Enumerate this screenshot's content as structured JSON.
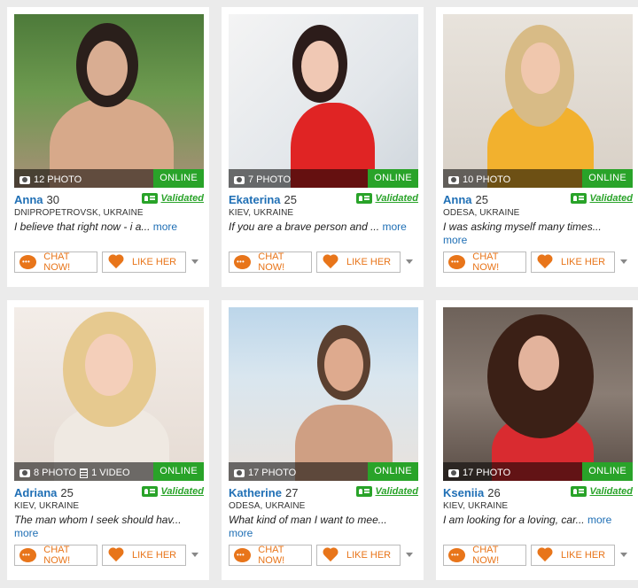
{
  "colors": {
    "online": "#29a329",
    "validated": "#29a329",
    "name": "#1f6fb5",
    "accent": "#e8751a"
  },
  "labels": {
    "online": "ONLINE",
    "validated": "Validated",
    "chat": "CHAT NOW!",
    "like": "LIKE HER",
    "more": "more"
  },
  "profiles": [
    {
      "photos": "12 PHOTO",
      "videos": "",
      "name": "Anna",
      "age": "30",
      "location": "DNIPROPETROVSK, UKRAINE",
      "bio": "I believe that right now - i a...",
      "more_inline": true
    },
    {
      "photos": "7 PHOTO",
      "videos": "",
      "name": "Ekaterina",
      "age": "25",
      "location": "KIEV, UKRAINE",
      "bio": "If you are a brave person and ...",
      "more_inline": true
    },
    {
      "photos": "10 PHOTO",
      "videos": "",
      "name": "Anna",
      "age": "25",
      "location": "ODESA, UKRAINE",
      "bio": "I was asking myself many times...",
      "more_inline": false
    },
    {
      "photos": "8 PHOTO",
      "videos": "1 VIDEO",
      "name": "Adriana",
      "age": "25",
      "location": "KIEV, UKRAINE",
      "bio": "The man whom I seek should hav...",
      "more_inline": false
    },
    {
      "photos": "17 PHOTO",
      "videos": "",
      "name": "Katherine",
      "age": "27",
      "location": "ODESA, UKRAINE",
      "bio": "What kind of man I want to mee...",
      "more_inline": false
    },
    {
      "photos": "17 PHOTO",
      "videos": "",
      "name": "Kseniia",
      "age": "26",
      "location": "KIEV, UKRAINE",
      "bio": "I am looking for a loving, car...",
      "more_inline": true
    }
  ]
}
